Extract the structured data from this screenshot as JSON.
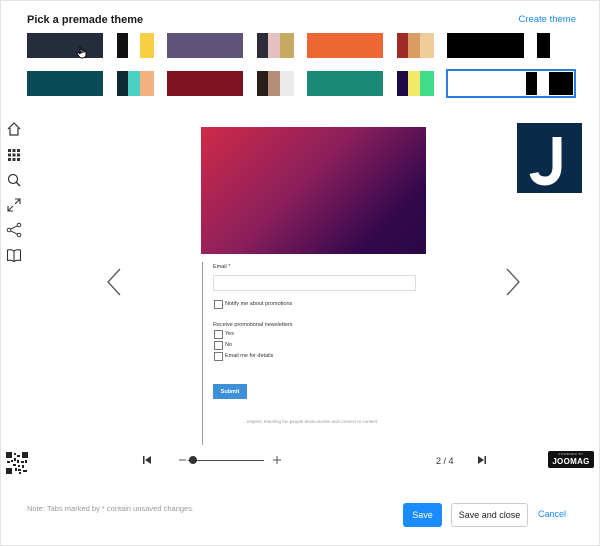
{
  "header": {
    "title": "Pick a premade theme",
    "create_label": "Create theme"
  },
  "themes": {
    "row1": [
      {
        "name": "theme-1",
        "colors": [
          "#252d3d"
        ]
      },
      {
        "name": "theme-2",
        "colors": [
          "#111111",
          "#ffffff",
          "#f7d046"
        ]
      },
      {
        "name": "theme-3",
        "colors": [
          "#5f537a"
        ]
      },
      {
        "name": "theme-4",
        "colors": [
          "#2c2c3a",
          "#e6c1c3",
          "#c6aa62"
        ]
      },
      {
        "name": "theme-5",
        "colors": [
          "#ec6733"
        ]
      },
      {
        "name": "theme-6",
        "colors": [
          "#9e2b25",
          "#d99d63",
          "#eecd9b"
        ]
      },
      {
        "name": "theme-7",
        "colors": [
          "#000000",
          "#ffffff",
          "#000000"
        ]
      }
    ],
    "row2": [
      {
        "name": "theme-8",
        "colors": [
          "#0b4b57"
        ]
      },
      {
        "name": "theme-9",
        "colors": [
          "#102a33",
          "#4bd0c5",
          "#f2b17f"
        ]
      },
      {
        "name": "theme-10",
        "colors": [
          "#7d1220"
        ]
      },
      {
        "name": "theme-11",
        "colors": [
          "#2a1f18",
          "#b58e7a",
          "#ebebeb"
        ]
      },
      {
        "name": "theme-12",
        "colors": [
          "#1a8a77"
        ]
      },
      {
        "name": "theme-13",
        "colors": [
          "#1e0b45",
          "#f2e96a",
          "#41dc8a"
        ]
      },
      {
        "name": "theme-14",
        "colors": [
          "#ffffff",
          "#000000",
          "#ffffff",
          "#000000"
        ]
      }
    ]
  },
  "toolbar": {
    "icons": [
      "home-icon",
      "grid-icon",
      "search-icon",
      "fullscreen-icon",
      "share-icon",
      "book-icon"
    ]
  },
  "form": {
    "email_label": "Email *",
    "notify_label": "Notify me about promotions",
    "newsletters_label": "Receive promotional newsletters",
    "option_yes": "Yes",
    "option_no": "No",
    "option_email": "Email me for details",
    "submit_label": "Submit",
    "faint_text": "...respect, teaching fun people dreas,stories and connect to content"
  },
  "viewer": {
    "logo_letter": "J"
  },
  "bottom": {
    "page_indicator": "2 / 4",
    "joomag_small": "POWERED BY",
    "joomag_big": "JOOMAG"
  },
  "footer": {
    "note": "Note: Tabs marked by * contain unsaved changes.",
    "save_label": "Save",
    "save_close_label": "Save and close",
    "cancel_label": "Cancel"
  },
  "colors": {
    "accent": "#1a8cff",
    "selected_outline": "#2a7de1"
  }
}
